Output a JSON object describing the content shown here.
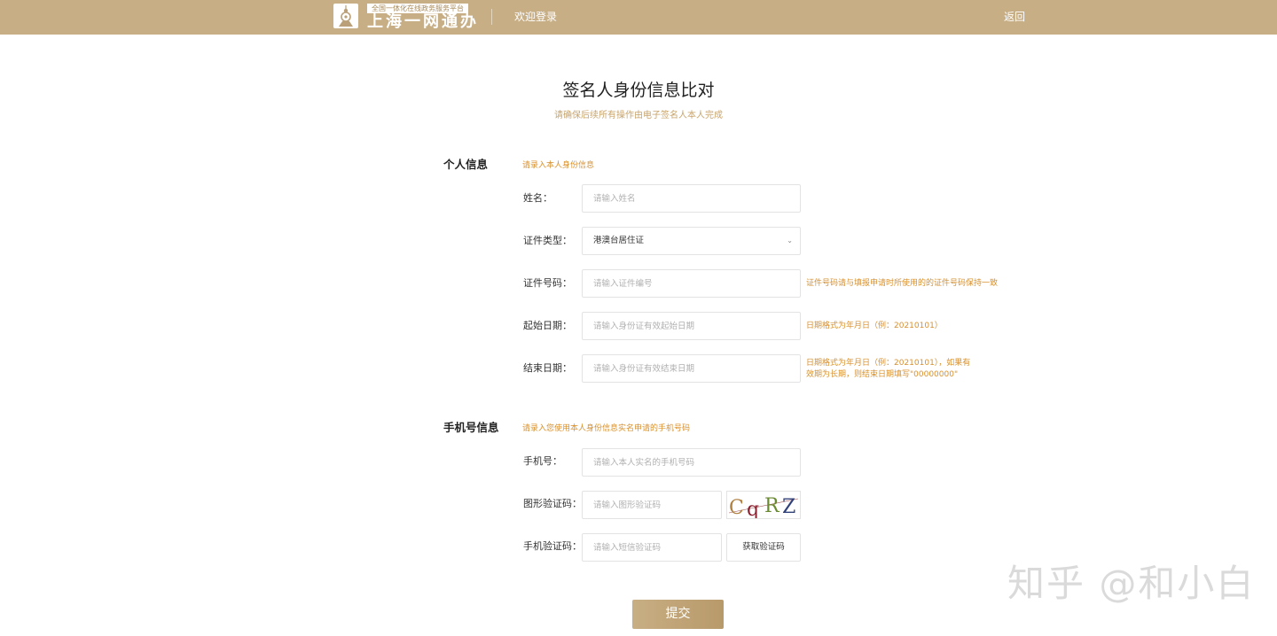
{
  "header": {
    "logo_subtitle": "全国一体化在线政务服务平台",
    "logo_title": "上海一网通办",
    "welcome": "欢迎登录",
    "back": "返回",
    "bg_color": "#c7ae85"
  },
  "page": {
    "title": "签名人身份信息比对",
    "subtitle": "请确保后续所有操作由电子签名人本人完成"
  },
  "personal": {
    "section_title": "个人信息",
    "hint": "请录入本人身份信息",
    "name_label": "姓名：",
    "name_placeholder": "请输入姓名",
    "id_type_label": "证件类型：",
    "id_type_value": "港澳台居住证",
    "id_number_label": "证件号码：",
    "id_number_placeholder": "请输入证件编号",
    "id_number_hint": "证件号码请与填报申请时所使用的的证件号码保持一致",
    "start_date_label": "起始日期：",
    "start_date_placeholder": "请输入身份证有效起始日期",
    "start_date_hint": "日期格式为年月日（例：20210101）",
    "end_date_label": "结束日期：",
    "end_date_placeholder": "请输入身份证有效结束日期",
    "end_date_hint_line1": "日期格式为年月日（例：20210101），如果有",
    "end_date_hint_line2": "效期为长期，则结束日期填写\"00000000\""
  },
  "phone": {
    "section_title": "手机号信息",
    "hint": "请录入您使用本人身份信息实名申请的手机号码",
    "phone_label": "手机号：",
    "phone_placeholder": "请输入本人实名的手机号码",
    "captcha_label": "图形验证码：",
    "captcha_placeholder": "请输入图形验证码",
    "captcha_text": [
      "C",
      "q",
      "R",
      "Z"
    ],
    "sms_label": "手机验证码：",
    "sms_placeholder": "请输入短信验证码",
    "sms_button": "获取验证码"
  },
  "submit": "提交",
  "watermark": "知乎 @和小白"
}
